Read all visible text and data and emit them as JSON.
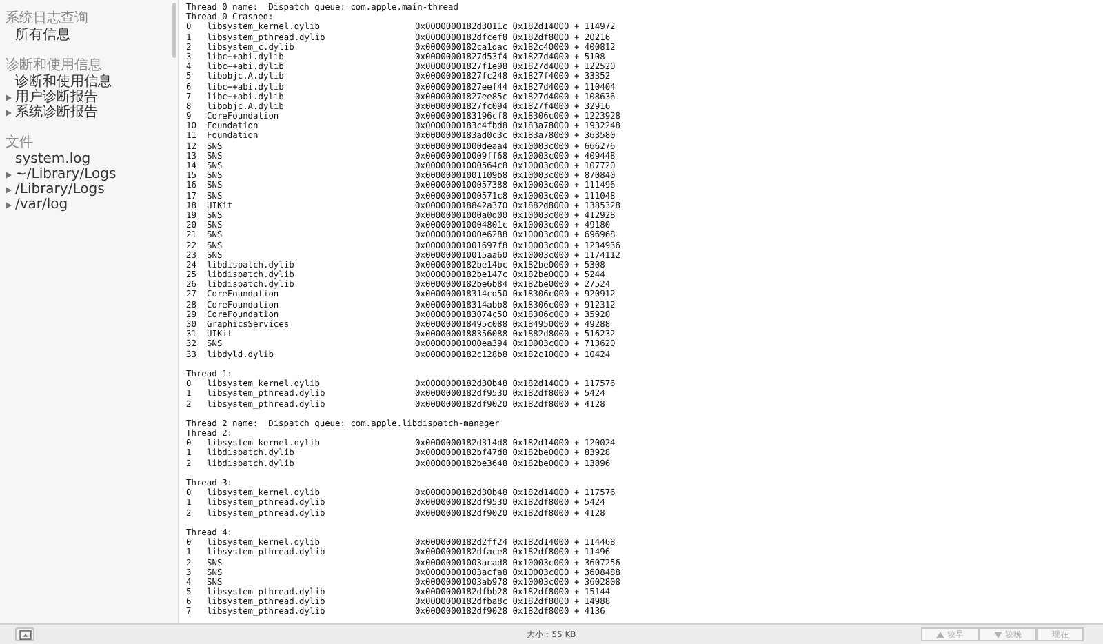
{
  "sidebar": {
    "sections": [
      {
        "header": "系统日志查询",
        "items": [
          {
            "label": "所有信息",
            "kind": "leaf"
          }
        ]
      },
      {
        "header": "诊断和使用信息",
        "items": [
          {
            "label": "诊断和使用信息",
            "kind": "leaf"
          },
          {
            "label": "用户诊断报告",
            "kind": "group",
            "expanded": false
          },
          {
            "label": "系统诊断报告",
            "kind": "group",
            "expanded": false
          }
        ]
      },
      {
        "header": "文件",
        "items": [
          {
            "label": "system.log",
            "kind": "leaf"
          },
          {
            "label": "~/Library/Logs",
            "kind": "group",
            "expanded": false
          },
          {
            "label": "/Library/Logs",
            "kind": "group",
            "expanded": false
          },
          {
            "label": "/var/log",
            "kind": "group",
            "expanded": false
          }
        ]
      }
    ]
  },
  "log": {
    "threads": [
      {
        "name_line": "Thread 0 name:  Dispatch queue: com.apple.main-thread",
        "title": "Thread 0 Crashed:",
        "frames": [
          [
            "0",
            "libsystem_kernel.dylib",
            "0x0000000182d3011c 0x182d14000 + 114972"
          ],
          [
            "1",
            "libsystem_pthread.dylib",
            "0x0000000182dfcef8 0x182df8000 + 20216"
          ],
          [
            "2",
            "libsystem_c.dylib",
            "0x0000000182ca1dac 0x182c40000 + 400812"
          ],
          [
            "3",
            "libc++abi.dylib",
            "0x00000001827d53f4 0x1827d4000 + 5108"
          ],
          [
            "4",
            "libc++abi.dylib",
            "0x00000001827f1e98 0x1827d4000 + 122520"
          ],
          [
            "5",
            "libobjc.A.dylib",
            "0x00000001827fc248 0x1827f4000 + 33352"
          ],
          [
            "6",
            "libc++abi.dylib",
            "0x00000001827eef44 0x1827d4000 + 110404"
          ],
          [
            "7",
            "libc++abi.dylib",
            "0x00000001827ee85c 0x1827d4000 + 108636"
          ],
          [
            "8",
            "libobjc.A.dylib",
            "0x00000001827fc094 0x1827f4000 + 32916"
          ],
          [
            "9",
            "CoreFoundation",
            "0x0000000183196cf8 0x18306c000 + 1223928"
          ],
          [
            "10",
            "Foundation",
            "0x0000000183c4fbd8 0x183a78000 + 1932248"
          ],
          [
            "11",
            "Foundation",
            "0x0000000183ad0c3c 0x183a78000 + 363580"
          ],
          [
            "12",
            "SNS",
            "0x00000001000deaa4 0x10003c000 + 666276"
          ],
          [
            "13",
            "SNS",
            "0x000000010009ff68 0x10003c000 + 409448"
          ],
          [
            "14",
            "SNS",
            "0x00000001000564c8 0x10003c000 + 107720"
          ],
          [
            "15",
            "SNS",
            "0x00000001001109b8 0x10003c000 + 870840"
          ],
          [
            "16",
            "SNS",
            "0x0000000100057388 0x10003c000 + 111496"
          ],
          [
            "17",
            "SNS",
            "0x00000001000571c8 0x10003c000 + 111048"
          ],
          [
            "18",
            "UIKit",
            "0x000000018842a370 0x1882d8000 + 1385328"
          ],
          [
            "19",
            "SNS",
            "0x00000001000a0d00 0x10003c000 + 412928"
          ],
          [
            "20",
            "SNS",
            "0x000000010004801c 0x10003c000 + 49180"
          ],
          [
            "21",
            "SNS",
            "0x00000001000e6288 0x10003c000 + 696968"
          ],
          [
            "22",
            "SNS",
            "0x00000001001697f8 0x10003c000 + 1234936"
          ],
          [
            "23",
            "SNS",
            "0x000000010015aa60 0x10003c000 + 1174112"
          ],
          [
            "24",
            "libdispatch.dylib",
            "0x0000000182be14bc 0x182be0000 + 5308"
          ],
          [
            "25",
            "libdispatch.dylib",
            "0x0000000182be147c 0x182be0000 + 5244"
          ],
          [
            "26",
            "libdispatch.dylib",
            "0x0000000182be6b84 0x182be0000 + 27524"
          ],
          [
            "27",
            "CoreFoundation",
            "0x000000018314cd50 0x18306c000 + 920912"
          ],
          [
            "28",
            "CoreFoundation",
            "0x000000018314abb8 0x18306c000 + 912312"
          ],
          [
            "29",
            "CoreFoundation",
            "0x0000000183074c50 0x18306c000 + 35920"
          ],
          [
            "30",
            "GraphicsServices",
            "0x000000018495c088 0x184950000 + 49288"
          ],
          [
            "31",
            "UIKit",
            "0x0000000188356088 0x1882d8000 + 516232"
          ],
          [
            "32",
            "SNS",
            "0x00000001000ea394 0x10003c000 + 713620"
          ],
          [
            "33",
            "libdyld.dylib",
            "0x0000000182c128b8 0x182c10000 + 10424"
          ]
        ]
      },
      {
        "title": "Thread 1:",
        "frames": [
          [
            "0",
            "libsystem_kernel.dylib",
            "0x0000000182d30b48 0x182d14000 + 117576"
          ],
          [
            "1",
            "libsystem_pthread.dylib",
            "0x0000000182df9530 0x182df8000 + 5424"
          ],
          [
            "2",
            "libsystem_pthread.dylib",
            "0x0000000182df9020 0x182df8000 + 4128"
          ]
        ]
      },
      {
        "name_line": "Thread 2 name:  Dispatch queue: com.apple.libdispatch-manager",
        "title": "Thread 2:",
        "frames": [
          [
            "0",
            "libsystem_kernel.dylib",
            "0x0000000182d314d8 0x182d14000 + 120024"
          ],
          [
            "1",
            "libdispatch.dylib",
            "0x0000000182bf47d8 0x182be0000 + 83928"
          ],
          [
            "2",
            "libdispatch.dylib",
            "0x0000000182be3648 0x182be0000 + 13896"
          ]
        ]
      },
      {
        "title": "Thread 3:",
        "frames": [
          [
            "0",
            "libsystem_kernel.dylib",
            "0x0000000182d30b48 0x182d14000 + 117576"
          ],
          [
            "1",
            "libsystem_pthread.dylib",
            "0x0000000182df9530 0x182df8000 + 5424"
          ],
          [
            "2",
            "libsystem_pthread.dylib",
            "0x0000000182df9020 0x182df8000 + 4128"
          ]
        ]
      },
      {
        "title": "Thread 4:",
        "frames": [
          [
            "0",
            "libsystem_kernel.dylib",
            "0x0000000182d2ff24 0x182d14000 + 114468"
          ],
          [
            "1",
            "libsystem_pthread.dylib",
            "0x0000000182dface8 0x182df8000 + 11496"
          ],
          [
            "2",
            "SNS",
            "0x00000001003acad8 0x10003c000 + 3607256"
          ],
          [
            "3",
            "SNS",
            "0x00000001003acfa8 0x10003c000 + 3608488"
          ],
          [
            "4",
            "SNS",
            "0x00000001003ab978 0x10003c000 + 3602808"
          ],
          [
            "5",
            "libsystem_pthread.dylib",
            "0x0000000182dfbb28 0x182df8000 + 15144"
          ],
          [
            "6",
            "libsystem_pthread.dylib",
            "0x0000000182dfba8c 0x182df8000 + 14988"
          ],
          [
            "7",
            "libsystem_pthread.dylib",
            "0x0000000182df9028 0x182df8000 + 4136"
          ]
        ]
      }
    ]
  },
  "status_bar": {
    "size": "大小：55 KB",
    "buttons": [
      {
        "label": "较早",
        "kind": "up",
        "disabled": true
      },
      {
        "label": "较晚",
        "kind": "down",
        "disabled": true
      },
      {
        "label": "现在",
        "kind": "plain",
        "disabled": true
      }
    ]
  }
}
